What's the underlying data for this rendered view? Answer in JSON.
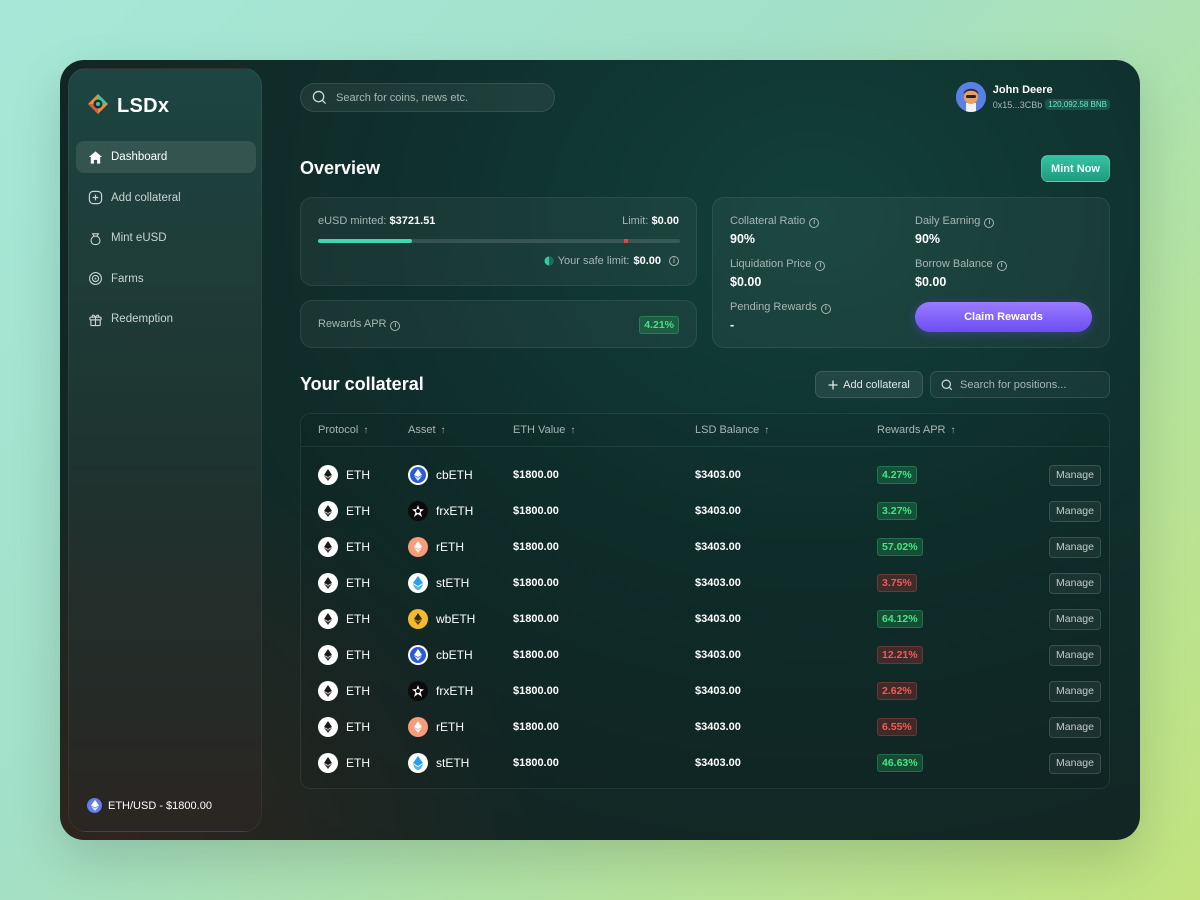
{
  "app": {
    "name": "LSDx"
  },
  "sidebar": {
    "items": [
      {
        "label": "Dashboard",
        "icon": "home-icon",
        "active": true
      },
      {
        "label": "Add collateral",
        "icon": "plus-square-icon",
        "active": false
      },
      {
        "label": "Mint eUSD",
        "icon": "bag-icon",
        "active": false
      },
      {
        "label": "Farms",
        "icon": "target-icon",
        "active": false
      },
      {
        "label": "Redemption",
        "icon": "gift-icon",
        "active": false
      }
    ],
    "footer": "ETH/USD - $1800.00"
  },
  "header": {
    "search_placeholder": "Search for coins, news etc.",
    "user": {
      "name": "John Deere",
      "address": "0x15...3CBb",
      "balance": "120,092.58 BNB"
    }
  },
  "overview": {
    "title": "Overview",
    "mint_button": "Mint Now",
    "minted_label": "eUSD minted:",
    "minted_value": "$3721.51",
    "limit_label": "Limit:",
    "limit_value": "$0.00",
    "progress_fraction": 0.26,
    "limit_marker_fraction": 0.845,
    "safe_limit_label": "Your safe limit:",
    "safe_limit_value": "$0.00",
    "rewards_apr_label": "Rewards APR",
    "rewards_apr_value": "4.21%",
    "stats": {
      "collateral_ratio_label": "Collateral Ratio",
      "collateral_ratio_value": "90%",
      "daily_earning_label": "Daily Earning",
      "daily_earning_value": "90%",
      "liquidation_price_label": "Liquidation Price",
      "liquidation_price_value": "$0.00",
      "borrow_balance_label": "Borrow Balance",
      "borrow_balance_value": "$0.00",
      "pending_rewards_label": "Pending Rewards",
      "pending_rewards_value": "-",
      "claim_button": "Claim Rewards"
    }
  },
  "collateral": {
    "title": "Your collateral",
    "add_button": "Add collateral",
    "search_placeholder": "Search for positions...",
    "columns": [
      "Protocol",
      "Asset",
      "ETH Value",
      "LSD Balance",
      "Rewards APR"
    ],
    "manage_label": "Manage",
    "rows": [
      {
        "protocol": "ETH",
        "asset": "cbETH",
        "eth_value": "$1800.00",
        "lsd_balance": "$3403.00",
        "apr": "4.27%",
        "apr_status": "positive"
      },
      {
        "protocol": "ETH",
        "asset": "frxETH",
        "eth_value": "$1800.00",
        "lsd_balance": "$3403.00",
        "apr": "3.27%",
        "apr_status": "positive"
      },
      {
        "protocol": "ETH",
        "asset": "rETH",
        "eth_value": "$1800.00",
        "lsd_balance": "$3403.00",
        "apr": "57.02%",
        "apr_status": "positive"
      },
      {
        "protocol": "ETH",
        "asset": "stETH",
        "eth_value": "$1800.00",
        "lsd_balance": "$3403.00",
        "apr": "3.75%",
        "apr_status": "negative"
      },
      {
        "protocol": "ETH",
        "asset": "wbETH",
        "eth_value": "$1800.00",
        "lsd_balance": "$3403.00",
        "apr": "64.12%",
        "apr_status": "positive"
      },
      {
        "protocol": "ETH",
        "asset": "cbETH",
        "eth_value": "$1800.00",
        "lsd_balance": "$3403.00",
        "apr": "12.21%",
        "apr_status": "negative"
      },
      {
        "protocol": "ETH",
        "asset": "frxETH",
        "eth_value": "$1800.00",
        "lsd_balance": "$3403.00",
        "apr": "2.62%",
        "apr_status": "negative"
      },
      {
        "protocol": "ETH",
        "asset": "rETH",
        "eth_value": "$1800.00",
        "lsd_balance": "$3403.00",
        "apr": "6.55%",
        "apr_status": "negative"
      },
      {
        "protocol": "ETH",
        "asset": "stETH",
        "eth_value": "$1800.00",
        "lsd_balance": "$3403.00",
        "apr": "46.63%",
        "apr_status": "positive"
      }
    ]
  },
  "colors": {
    "accent_teal": "#3fd6b0",
    "accent_purple": "#7c5cf8",
    "positive": "#42e583",
    "negative": "#f05a5a"
  }
}
